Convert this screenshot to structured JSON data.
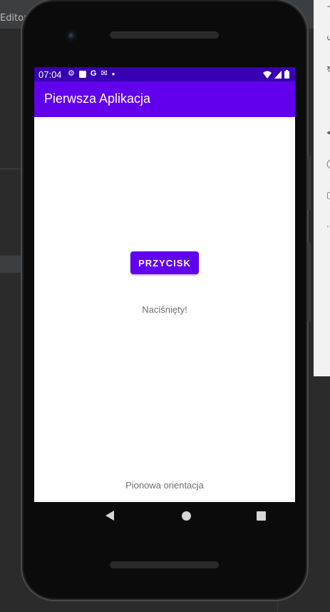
{
  "ide": {
    "editor_label": "Editor"
  },
  "status_bar": {
    "time": "07:04",
    "icons": [
      "settings-icon",
      "a-box-icon",
      "google-icon",
      "gmail-icon",
      "dot-icon"
    ],
    "right_icons": [
      "wifi-icon",
      "signal-icon",
      "battery-icon"
    ]
  },
  "app_bar": {
    "title": "Pierwsza Aplikacja"
  },
  "main": {
    "button_label": "PRZYCISK",
    "pressed_text": "Naciśnięty!",
    "orientation_text": "Pionowa orientacja"
  },
  "nav_bar": {
    "items": [
      "back-icon",
      "home-icon",
      "recents-icon"
    ]
  },
  "colors": {
    "status_bar": "#3700b3",
    "primary": "#6200ee",
    "ide_background": "#2b2b2b"
  }
}
